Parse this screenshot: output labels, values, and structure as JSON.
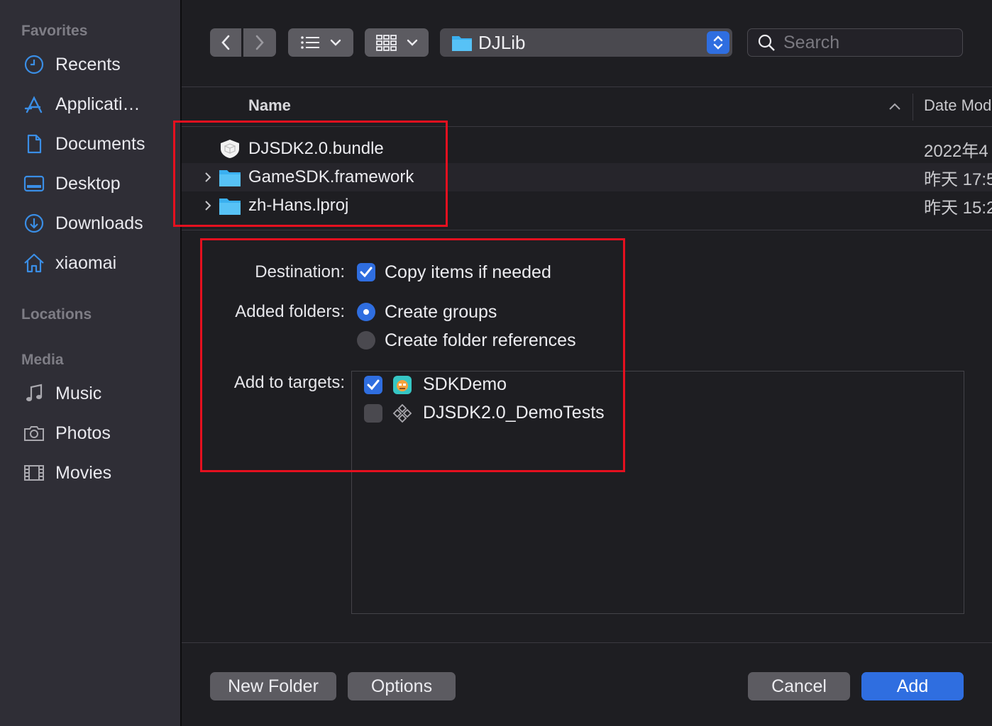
{
  "sidebar": {
    "sections": {
      "favorites": "Favorites",
      "locations": "Locations",
      "media": "Media"
    },
    "favorites": [
      {
        "label": "Recents",
        "icon": "clock-icon"
      },
      {
        "label": "Applicati…",
        "icon": "applications-icon"
      },
      {
        "label": "Documents",
        "icon": "document-icon"
      },
      {
        "label": "Desktop",
        "icon": "desktop-icon"
      },
      {
        "label": "Downloads",
        "icon": "download-icon"
      },
      {
        "label": "xiaomai",
        "icon": "home-icon"
      }
    ],
    "media": [
      {
        "label": "Music",
        "icon": "music-icon"
      },
      {
        "label": "Photos",
        "icon": "camera-icon"
      },
      {
        "label": "Movies",
        "icon": "film-icon"
      }
    ]
  },
  "toolbar": {
    "path_label": "DJLib",
    "search_placeholder": "Search"
  },
  "file_list": {
    "columns": {
      "name": "Name",
      "date": "Date Mod"
    },
    "rows": [
      {
        "name": "DJSDK2.0.bundle",
        "date": "2022年4",
        "icon": "bundle-icon",
        "expandable": false
      },
      {
        "name": "GameSDK.framework",
        "date": "昨天 17:5",
        "icon": "folder-icon",
        "expandable": true
      },
      {
        "name": "zh-Hans.lproj",
        "date": "昨天 15:2",
        "icon": "folder-icon",
        "expandable": true
      }
    ]
  },
  "options": {
    "destination_label": "Destination:",
    "copy_items_label": "Copy items if needed",
    "copy_items_checked": true,
    "added_folders_label": "Added folders:",
    "create_groups_label": "Create groups",
    "create_folder_refs_label": "Create folder references",
    "selected_folder_option": "Create groups",
    "add_to_targets_label": "Add to targets:",
    "targets": [
      {
        "name": "SDKDemo",
        "checked": true,
        "icon": "app-target-icon"
      },
      {
        "name": "DJSDK2.0_DemoTests",
        "checked": false,
        "icon": "test-target-icon"
      }
    ]
  },
  "buttons": {
    "new_folder": "New Folder",
    "options": "Options",
    "cancel": "Cancel",
    "add": "Add"
  },
  "colors": {
    "accent": "#2f6ee0",
    "highlight_box": "#e5101f",
    "folder_blue": "#3ab0f0"
  }
}
